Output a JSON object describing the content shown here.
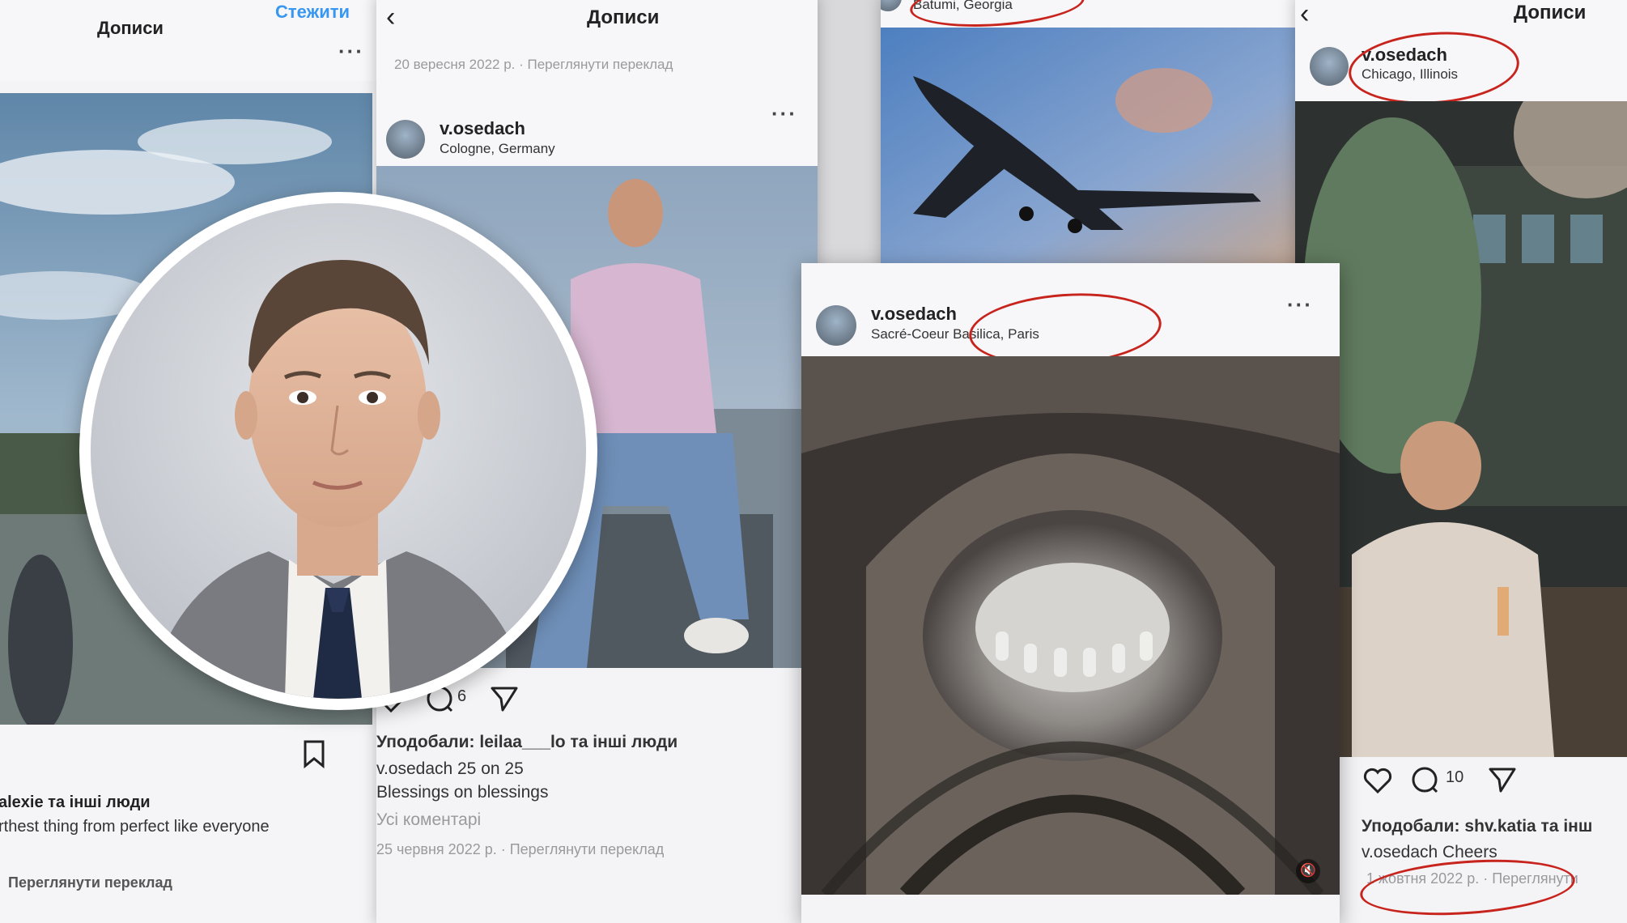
{
  "posts": {
    "left": {
      "header_title": "Дописи",
      "follow": "Стежити",
      "liked": "alexie та інші люди",
      "caption": "rthest thing from perfect like everyone",
      "translate": "Переглянути переклад"
    },
    "cologne": {
      "header_title": "Дописи",
      "date_line": "20 вересня 2022 р. · Переглянути переклад",
      "username": "v.osedach",
      "location": "Cologne, Germany",
      "comment_count": "6",
      "liked_by": "Уподобали: leilaa___lo та інші люди",
      "caption_line1": "v.osedach 25 on 25",
      "caption_line2": "Blessings on blessings",
      "all_comments": "Усі коментарі",
      "date_bottom": "25 червня 2022 р. · Переглянути переклад"
    },
    "batumi": {
      "location": "Batumi, Georgia"
    },
    "paris": {
      "username": "v.osedach",
      "location": "Sacré-Coeur Basilica, Paris"
    },
    "chicago": {
      "header_title": "Дописи",
      "username": "v.osedach",
      "location": "Chicago, Illinois",
      "comment_count": "10",
      "liked_by": "Уподобали: shv.katia та інш",
      "caption": "v.osedach Cheers",
      "date_bottom": "1 жовтня 2022 р. · Переглянути"
    }
  },
  "colors": {
    "highlight": "#c8241e",
    "link": "#3897f0"
  }
}
